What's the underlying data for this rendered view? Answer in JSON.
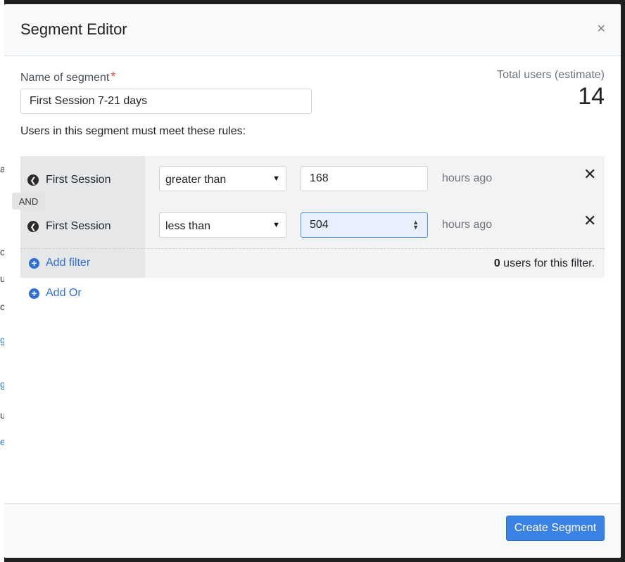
{
  "modal": {
    "title": "Segment Editor",
    "close_label": "×"
  },
  "segment": {
    "name_label": "Name of segment",
    "required_mark": "*",
    "name_value": "First Session 7-21 days",
    "rules_text": "Users in this segment must meet these rules:"
  },
  "estimate": {
    "label": "Total users (estimate)",
    "count": "14"
  },
  "rules": {
    "connector": "AND",
    "filters": [
      {
        "field": "First Session",
        "operator": "greater than",
        "value": "168",
        "unit": "hours ago",
        "remove": "✕"
      },
      {
        "field": "First Session",
        "operator": "less than",
        "value": "504",
        "unit": "hours ago",
        "remove": "✕"
      }
    ],
    "add_filter": "Add filter",
    "users_count": "0",
    "users_suffix": " users for this filter.",
    "add_or": "Add Or"
  },
  "footer": {
    "create_label": "Create Segment"
  },
  "background": {
    "chars": [
      "a",
      "c",
      "u",
      "c",
      "g",
      "g",
      "u",
      "e"
    ]
  },
  "colors": {
    "accent": "#3b82e6",
    "link": "#2f6fd8",
    "required": "#d9534f",
    "focus_bg": "#e8f0fe"
  },
  "icons": {
    "field": "arrow-left-circle-icon",
    "add": "plus-circle-icon",
    "remove": "close-icon",
    "dropdown": "caret-down-icon",
    "spinner": "spinner-icon"
  }
}
